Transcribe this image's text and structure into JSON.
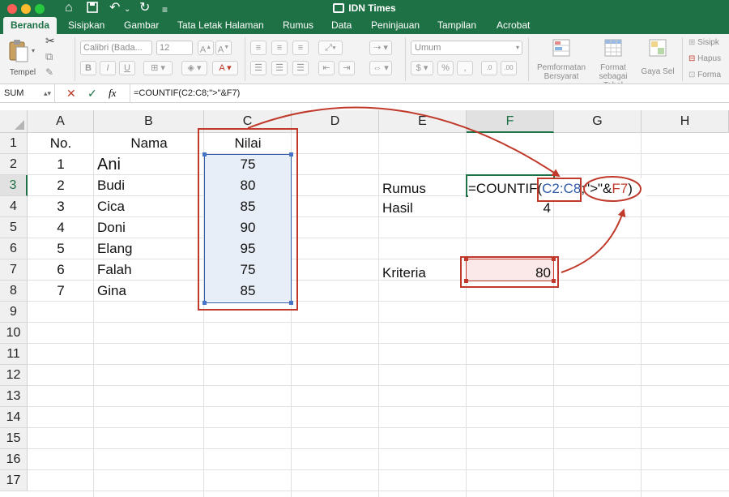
{
  "window": {
    "title": "IDN Times"
  },
  "quick_access": [
    "home-icon",
    "save-icon",
    "undo-icon",
    "redo-icon",
    "more-icon"
  ],
  "tabs": [
    "Beranda",
    "Sisipkan",
    "Gambar",
    "Tata Letak Halaman",
    "Rumus",
    "Data",
    "Peninjauan",
    "Tampilan",
    "Acrobat"
  ],
  "active_tab": "Beranda",
  "ribbon": {
    "paste_label": "Tempel",
    "font_name": "Calibri (Bada...",
    "font_size": "12",
    "bold": "B",
    "italic": "I",
    "underline": "U",
    "number_format": "Umum",
    "conditional_format_label": "Pemformatan Bersyarat",
    "format_table_label": "Format sebagai Tabel",
    "cell_styles_label": "Gaya Sel",
    "insert_label": "Sisipk",
    "delete_label": "Hapus",
    "format_label": "Forma"
  },
  "formula_bar": {
    "name_box": "SUM",
    "cancel": "✕",
    "enter": "✓",
    "fx": "fx",
    "formula": "=COUNTIF(C2:C8;\">\"&F7)"
  },
  "columns": [
    "A",
    "B",
    "C",
    "D",
    "E",
    "F",
    "G",
    "H"
  ],
  "rows": [
    "1",
    "2",
    "3",
    "4",
    "5",
    "6",
    "7",
    "8",
    "9",
    "10",
    "11",
    "12",
    "13",
    "14",
    "15",
    "16",
    "17"
  ],
  "headers": {
    "no": "No.",
    "nama": "Nama",
    "nilai": "Nilai"
  },
  "table": [
    {
      "no": "1",
      "nama": "Ani",
      "nilai": "75"
    },
    {
      "no": "2",
      "nama": "Budi",
      "nilai": "80"
    },
    {
      "no": "3",
      "nama": "Cica",
      "nilai": "85"
    },
    {
      "no": "4",
      "nama": "Doni",
      "nilai": "90"
    },
    {
      "no": "5",
      "nama": "Elang",
      "nilai": "95"
    },
    {
      "no": "6",
      "nama": "Falah",
      "nilai": "75"
    },
    {
      "no": "7",
      "nama": "Gina",
      "nilai": "85"
    }
  ],
  "side": {
    "rumus_label": "Rumus",
    "hasil_label": "Hasil",
    "hasil_value": "4",
    "kriteria_label": "Kriteria",
    "kriteria_value": "80"
  },
  "cell_formula": {
    "prefix": "=COUNTIF(",
    "range": "C2:C8",
    "sep": ";",
    "criteria": "\">\"&",
    "ref": "F7",
    "suffix": ")"
  },
  "colors": {
    "excel_green": "#1e7145",
    "annotation_red": "#c0392b",
    "range_blue": "#2f5aa8"
  }
}
